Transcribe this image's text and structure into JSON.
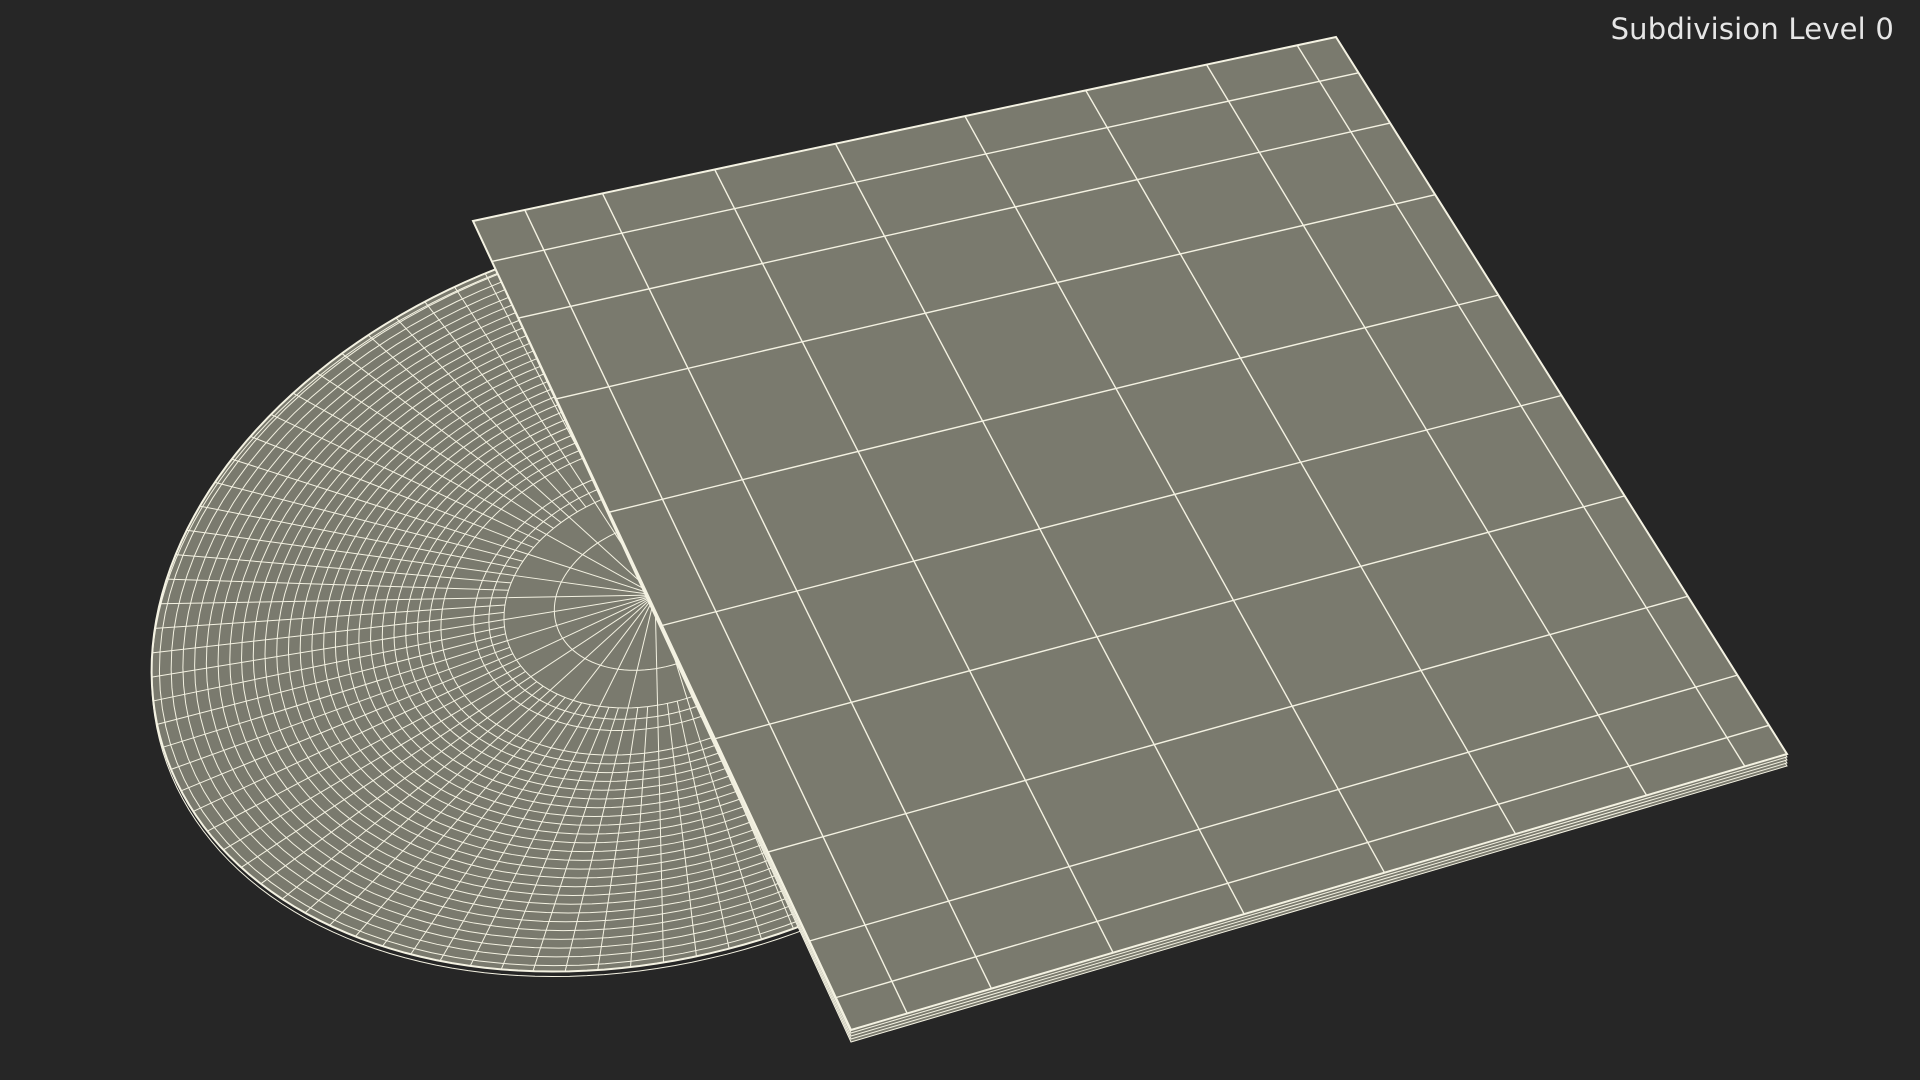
{
  "viewport": {
    "label": "Subdivision Level 0",
    "background_color": "#262626",
    "model": {
      "description_name": "vinyl-record-with-sleeve-wireframe",
      "surface_color": "#7a7a6e",
      "wire_color": "#f4f2e2"
    }
  }
}
